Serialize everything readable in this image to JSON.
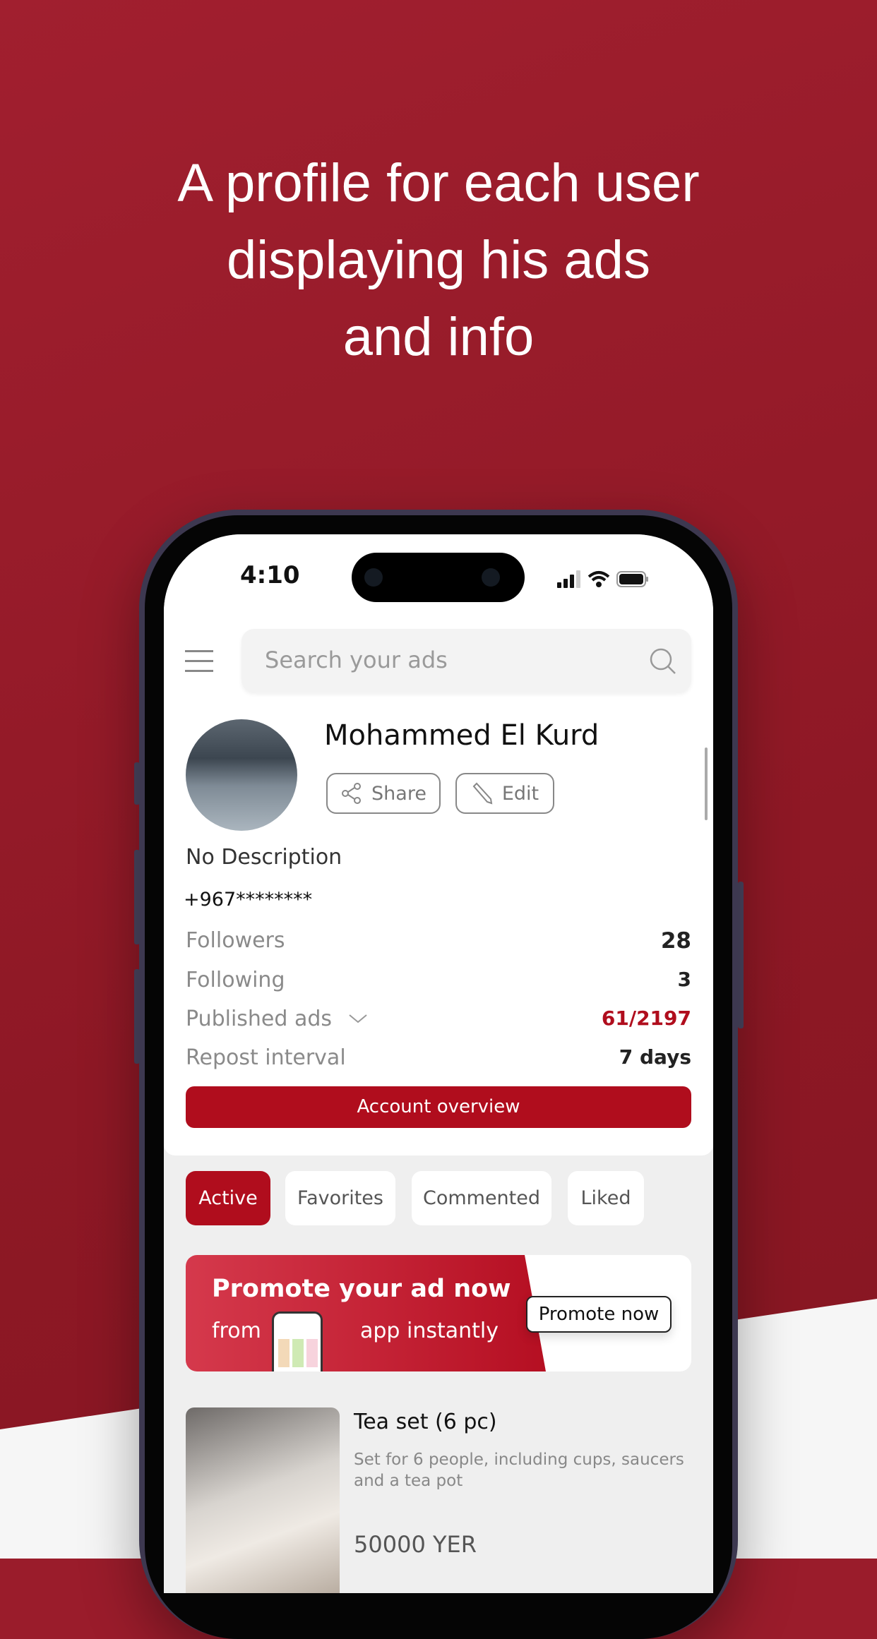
{
  "headline": [
    "A profile for each user",
    "displaying his ads",
    "and info"
  ],
  "status": {
    "time": "4:10"
  },
  "search": {
    "placeholder": "Search your ads"
  },
  "profile": {
    "name": "Mohammed El Kurd",
    "share": "Share",
    "edit": "Edit",
    "description": "No Description",
    "phone": "+967********"
  },
  "stats": [
    {
      "label": "Followers",
      "value": "28"
    },
    {
      "label": "Following",
      "value": "3"
    },
    {
      "label": "Published ads",
      "value": "61/2197"
    },
    {
      "label": "Repost interval",
      "value": "7 days"
    }
  ],
  "account_overview": "Account overview",
  "tabs": [
    {
      "label": "Active"
    },
    {
      "label": "Favorites"
    },
    {
      "label": "Commented"
    },
    {
      "label": "Liked"
    }
  ],
  "promo": {
    "line1": "Promote your ad now",
    "from": "from",
    "rest": "app instantly",
    "button": "Promote now"
  },
  "listing": {
    "title": "Tea set (6 pc)",
    "description": "Set for 6 people, including cups, saucers and a tea pot",
    "price": "50000 YER"
  },
  "colors": {
    "brand": "#b00d1d",
    "background": "#9a1c2b"
  }
}
